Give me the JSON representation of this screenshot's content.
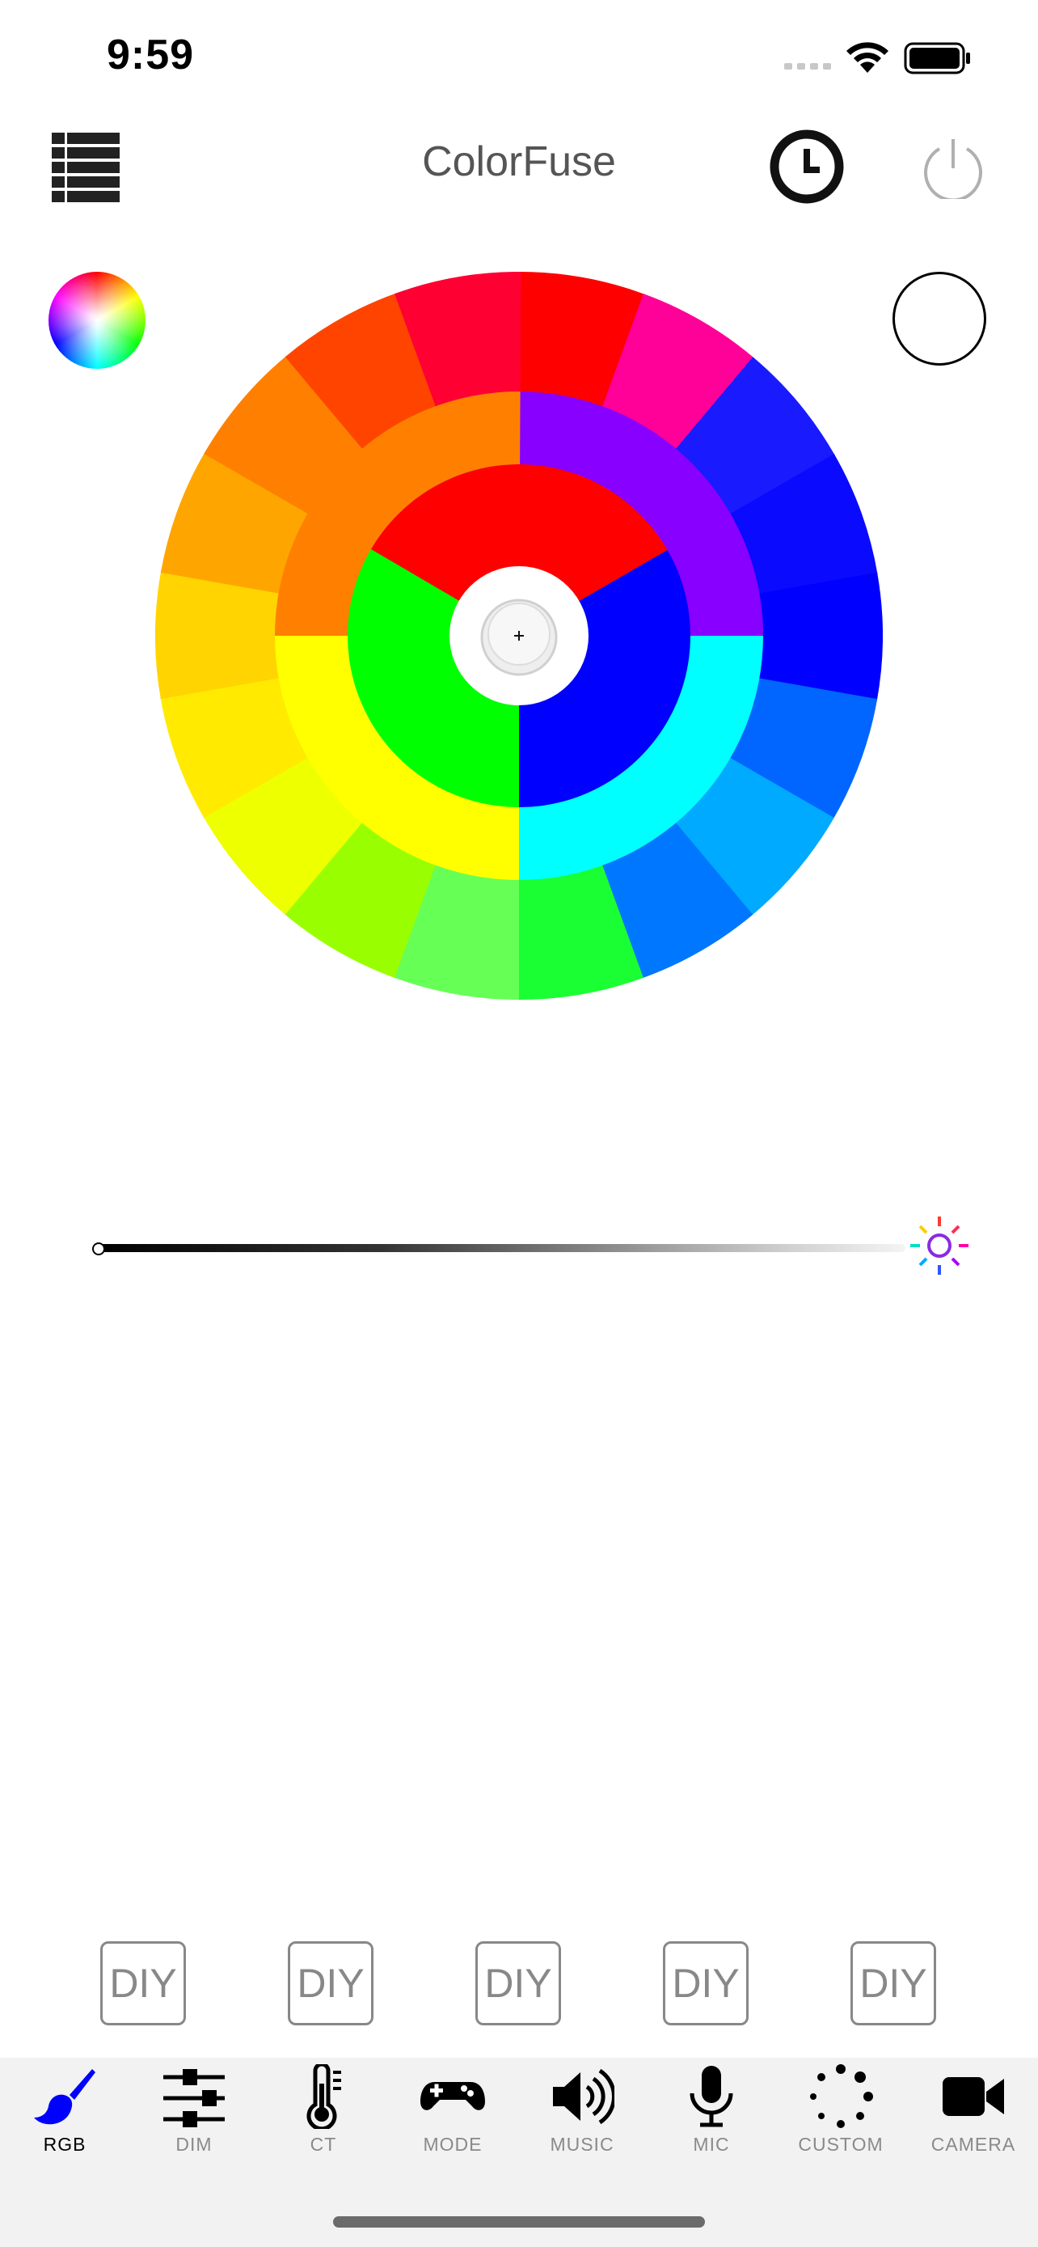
{
  "status_bar": {
    "time": "9:59"
  },
  "header": {
    "title": "ColorFuse"
  },
  "icons": {
    "menu": "list-menu-icon",
    "timer": "clock-icon",
    "power": "power-icon",
    "palette": "color-palette-icon",
    "brightness": "sun-icon"
  },
  "colors": {
    "tab_active": "#0000ff",
    "tab_inactive": "#000000",
    "wheel_outer": [
      "#ff0000",
      "#ff0099",
      "#1a1aff",
      "#0a0aff",
      "#0000ff",
      "#0066ff",
      "#00aaff",
      "#0077ff",
      "#1aff33",
      "#66ff55",
      "#99ff00",
      "#eeff00",
      "#ffea00",
      "#ffd400",
      "#ffa500",
      "#ff8000",
      "#ff4400",
      "#ff0033"
    ],
    "wheel_middle": [
      "#8800ff",
      "#00ffff",
      "#ffff00",
      "#ff8000"
    ],
    "wheel_inner": [
      "#ff0000",
      "#0000ff",
      "#00ff00"
    ]
  },
  "diy_buttons": [
    {
      "label": "DIY"
    },
    {
      "label": "DIY"
    },
    {
      "label": "DIY"
    },
    {
      "label": "DIY"
    },
    {
      "label": "DIY"
    }
  ],
  "tabs": [
    {
      "label": "RGB",
      "icon": "paintbrush-icon",
      "active": true
    },
    {
      "label": "DIM",
      "icon": "sliders-icon",
      "active": false
    },
    {
      "label": "CT",
      "icon": "thermometer-icon",
      "active": false
    },
    {
      "label": "MODE",
      "icon": "gamepad-icon",
      "active": false
    },
    {
      "label": "MUSIC",
      "icon": "speaker-icon",
      "active": false
    },
    {
      "label": "MIC",
      "icon": "microphone-icon",
      "active": false
    },
    {
      "label": "CUSTOM",
      "icon": "dots-circle-icon",
      "active": false
    },
    {
      "label": "CAMERA",
      "icon": "video-camera-icon",
      "active": false
    }
  ]
}
